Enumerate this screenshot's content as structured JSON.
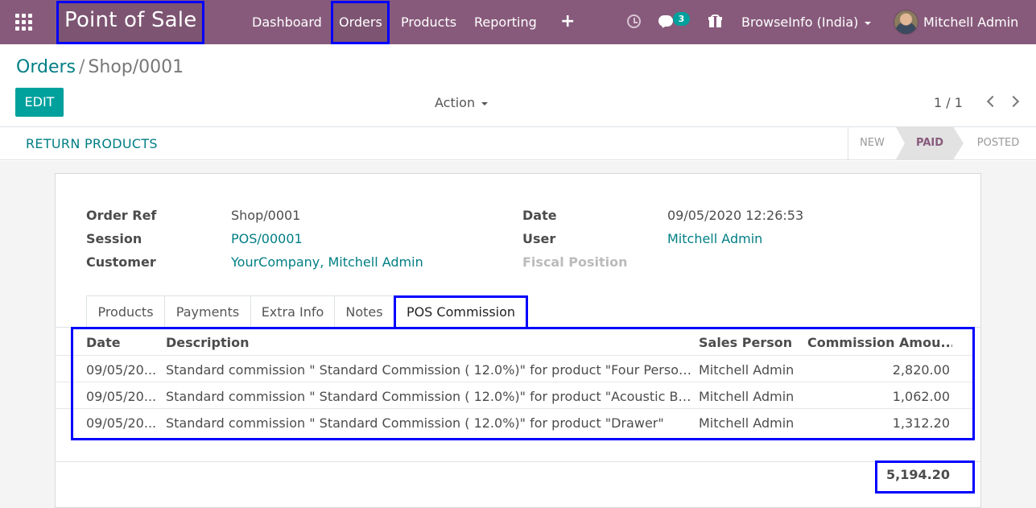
{
  "navbar": {
    "brand": "Point of Sale",
    "menu": [
      "Dashboard",
      "Orders",
      "Products",
      "Reporting"
    ],
    "message_count": "3",
    "company": "BrowseInfo (India)",
    "user": "Mitchell Admin",
    "icons": [
      "apps-grid-icon",
      "plus-icon",
      "clock-icon",
      "chat-icon",
      "gift-icon",
      "avatar"
    ]
  },
  "breadcrumb": {
    "parent": "Orders",
    "separator": "/",
    "current": "Shop/0001"
  },
  "control": {
    "edit_label": "EDIT",
    "action_label": "Action",
    "pager": "1 / 1"
  },
  "statusbar": {
    "return_label": "RETURN PRODUCTS",
    "stages": [
      "NEW",
      "PAID",
      "POSTED"
    ],
    "active_stage": "PAID"
  },
  "form": {
    "order_ref_label": "Order Ref",
    "order_ref": "Shop/0001",
    "session_label": "Session",
    "session": "POS/00001",
    "customer_label": "Customer",
    "customer": "YourCompany, Mitchell Admin",
    "date_label": "Date",
    "date": "09/05/2020 12:26:53",
    "user_label": "User",
    "user": "Mitchell Admin",
    "fiscal_label": "Fiscal Position"
  },
  "tabs": [
    "Products",
    "Payments",
    "Extra Info",
    "Notes",
    "POS Commission"
  ],
  "active_tab": "POS Commission",
  "commission_table": {
    "headers": [
      "Date",
      "Description",
      "Sales Person",
      "Commission Amou..."
    ],
    "rows": [
      [
        "09/05/20...",
        "Standard commission \" Standard Commission ( 12.0%)\" for product \"Four Person ...",
        "Mitchell Admin",
        "2,820.00"
      ],
      [
        "09/05/20...",
        "Standard commission \" Standard Commission ( 12.0%)\" for product \"Acoustic Blo...",
        "Mitchell Admin",
        "1,062.00"
      ],
      [
        "09/05/20...",
        "Standard commission \" Standard Commission ( 12.0%)\" for product \"Drawer\"",
        "Mitchell Admin",
        "1,312.20"
      ]
    ],
    "total": "5,194.20"
  },
  "colors": {
    "navbar": "#875a7b",
    "accent": "#00a09d",
    "link": "#017e84",
    "highlight_box": "#0000ff"
  }
}
